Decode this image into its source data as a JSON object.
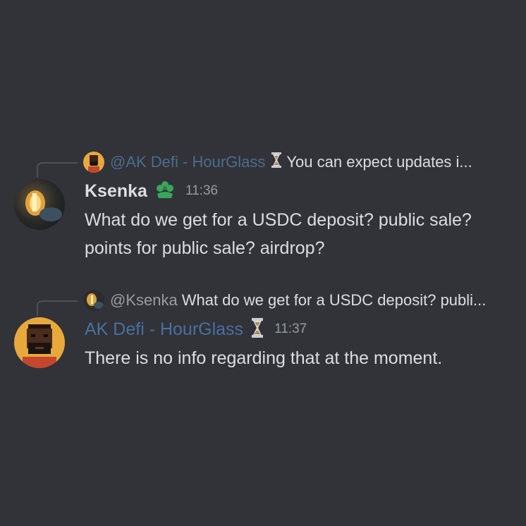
{
  "messages": [
    {
      "reply": {
        "author": "@AK Defi - HourGlass",
        "preview": "You can expect updates i..."
      },
      "author": "Ksenka",
      "role_icon": "flower-badge-icon",
      "timestamp": "11:36",
      "content": "What do we get for a USDC deposit? public sale?\npoints for public sale? airdrop?"
    },
    {
      "reply": {
        "author": "@Ksenka",
        "preview": "What do we get for a USDC deposit? publi..."
      },
      "author": "AK Defi - HourGlass",
      "role_icon": "hourglass-icon",
      "timestamp": "11:37",
      "content": "There is no info regarding that at the moment."
    }
  ],
  "colors": {
    "background": "#313338",
    "text": "#dbdee1",
    "muted": "#949ba4",
    "ak_author": "#4a6fa0",
    "role_green": "#3ba55d"
  }
}
